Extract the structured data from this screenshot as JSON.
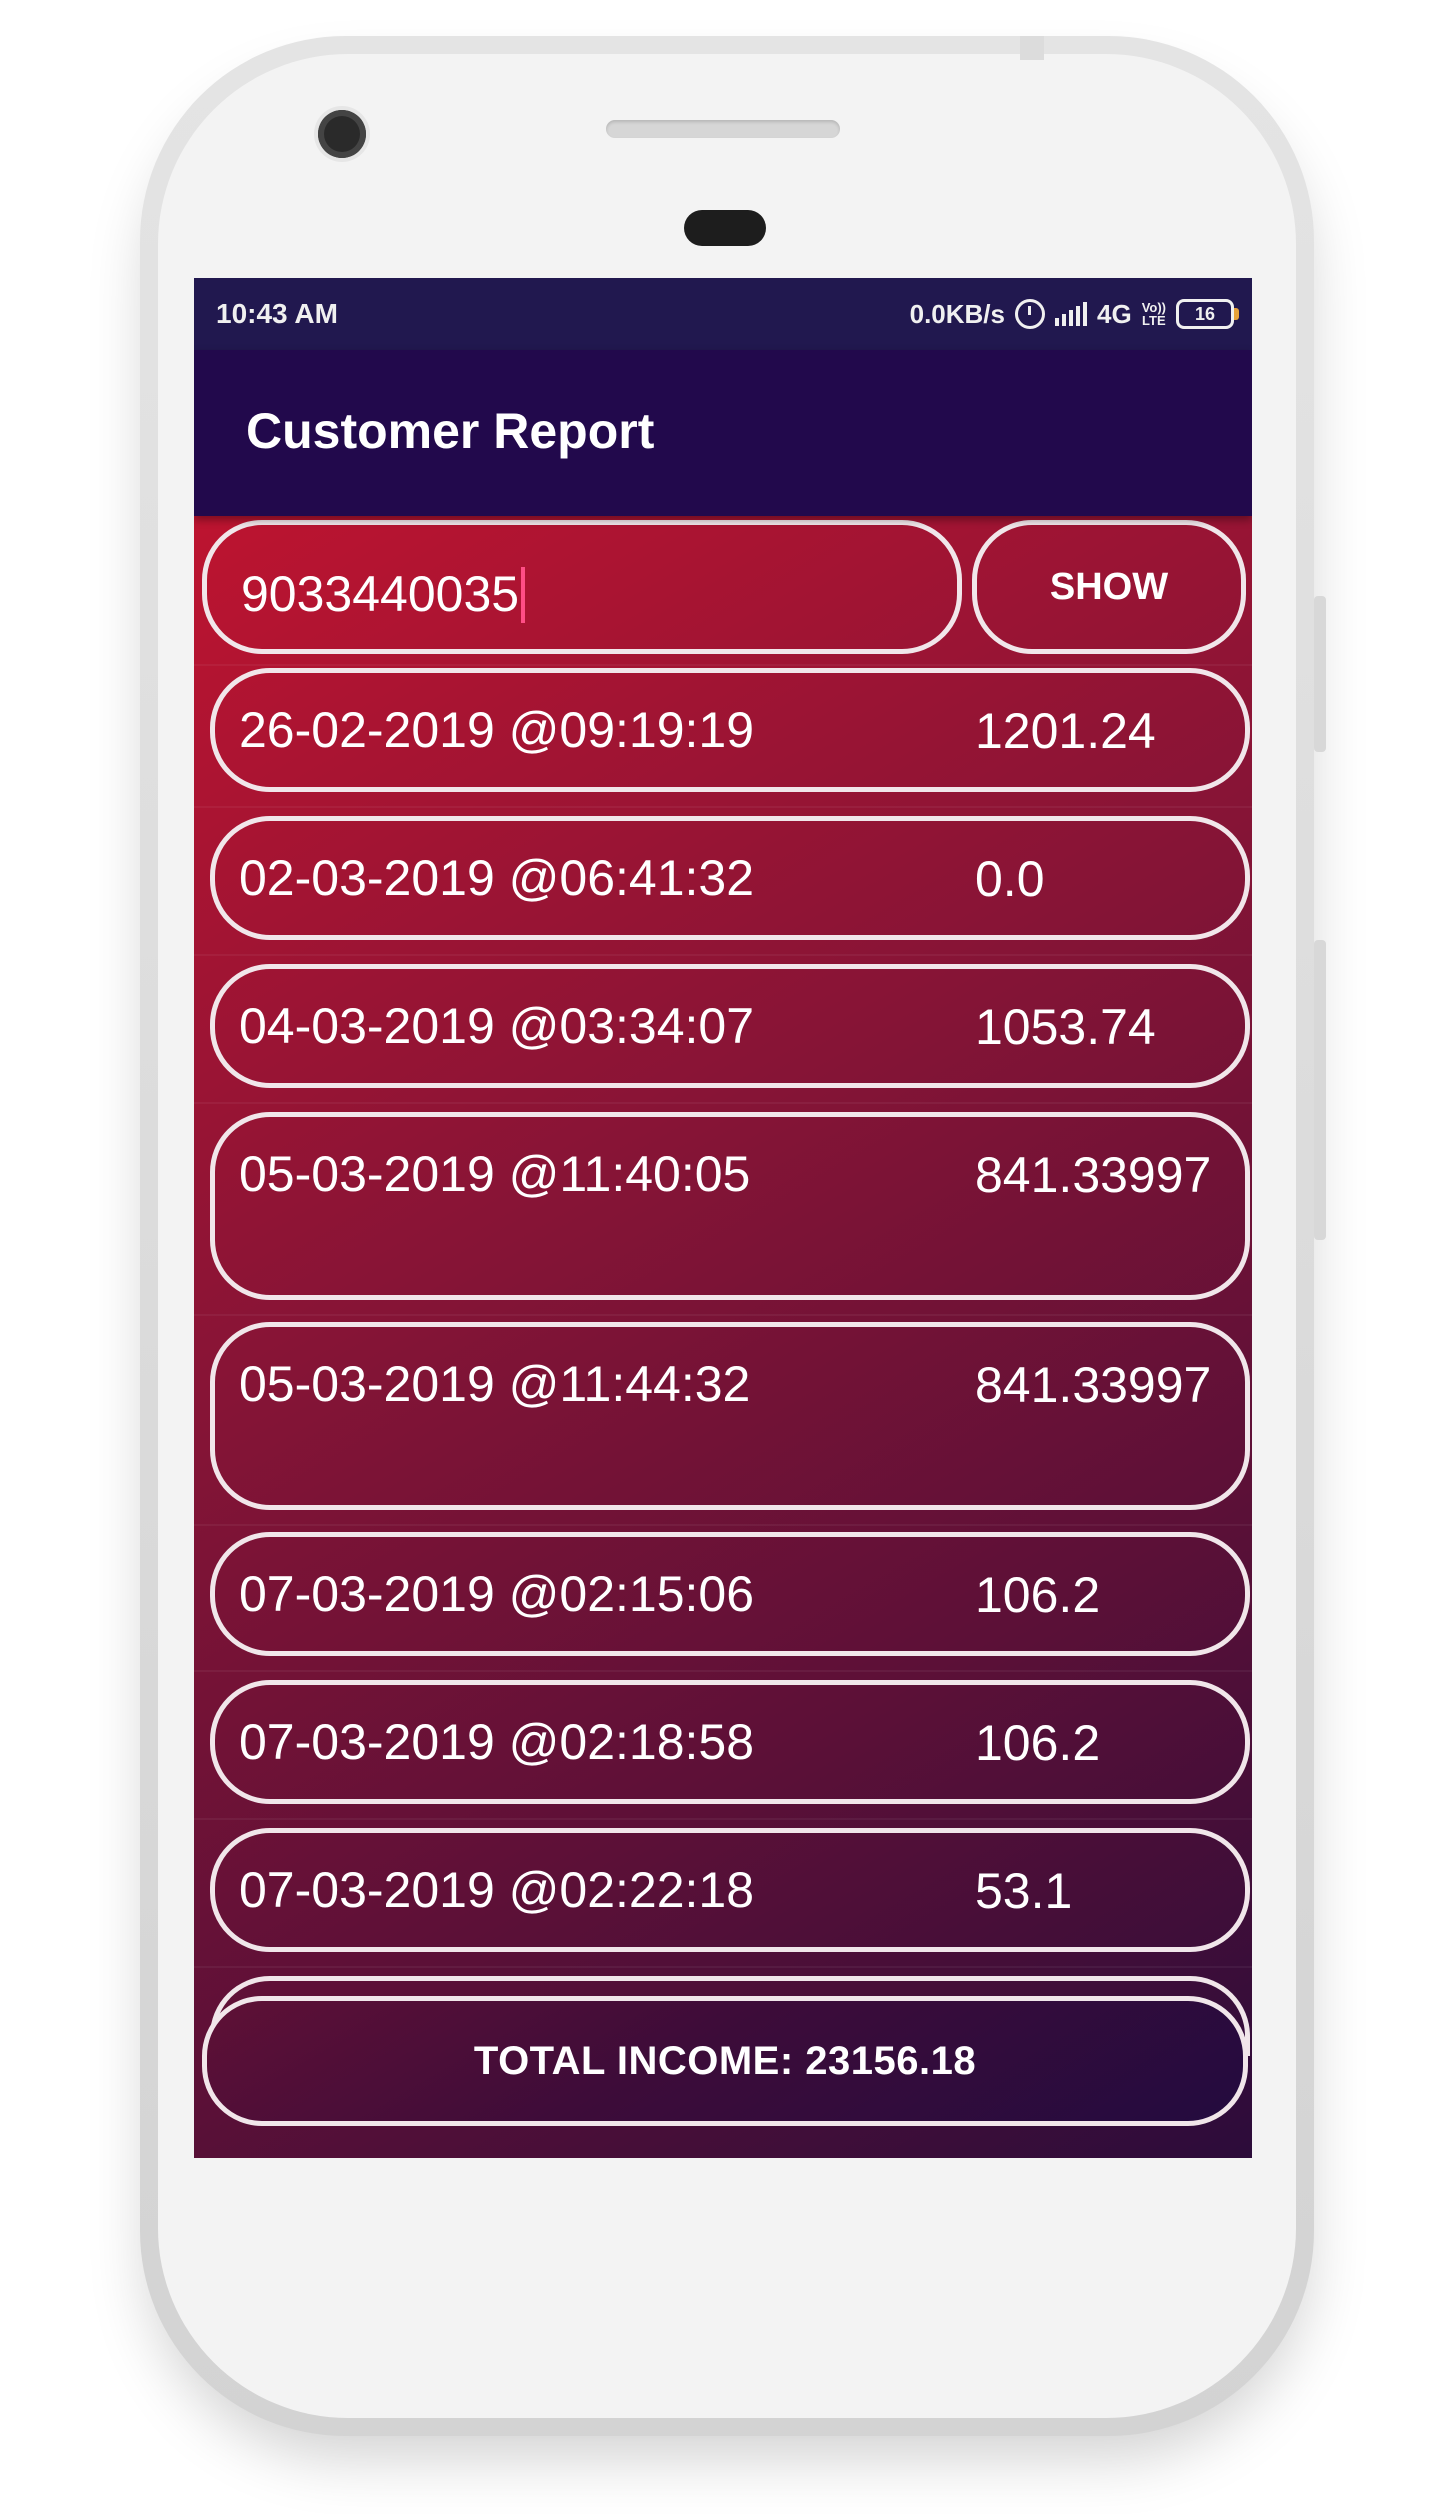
{
  "status_bar": {
    "time": "10:43 AM",
    "network_speed": "0.0KB/s",
    "network_type": "4G",
    "volte_line1": "Vo))",
    "volte_line2": "LTE",
    "battery_level": "16",
    "icons": [
      "alarm-icon",
      "signal-icon",
      "battery-icon"
    ]
  },
  "app_bar": {
    "title": "Customer Report"
  },
  "search": {
    "value": "9033440035",
    "show_label": "SHOW"
  },
  "records": [
    {
      "date": "26-02-2019 @09:19:19",
      "amount": "1201.24"
    },
    {
      "date": "02-03-2019 @06:41:32",
      "amount": "0.0"
    },
    {
      "date": "04-03-2019 @03:34:07",
      "amount": "1053.74"
    },
    {
      "date": "05-03-2019 @11:40:05",
      "amount": "841.33997"
    },
    {
      "date": "05-03-2019 @11:44:32",
      "amount": "841.33997"
    },
    {
      "date": "07-03-2019 @02:15:06",
      "amount": "106.2"
    },
    {
      "date": "07-03-2019 @02:18:58",
      "amount": "106.2"
    },
    {
      "date": "07-03-2019 @02:22:18",
      "amount": "53.1"
    }
  ],
  "total": {
    "label": "TOTAL INCOME: 23156.18"
  },
  "colors": {
    "app_bar": "#22094c",
    "status_bar": "#21184f",
    "gradient_start": "#bd1430",
    "gradient_end": "#2c0c3a",
    "outline": "#f1e6ea",
    "cursor": "#ff4e86"
  }
}
